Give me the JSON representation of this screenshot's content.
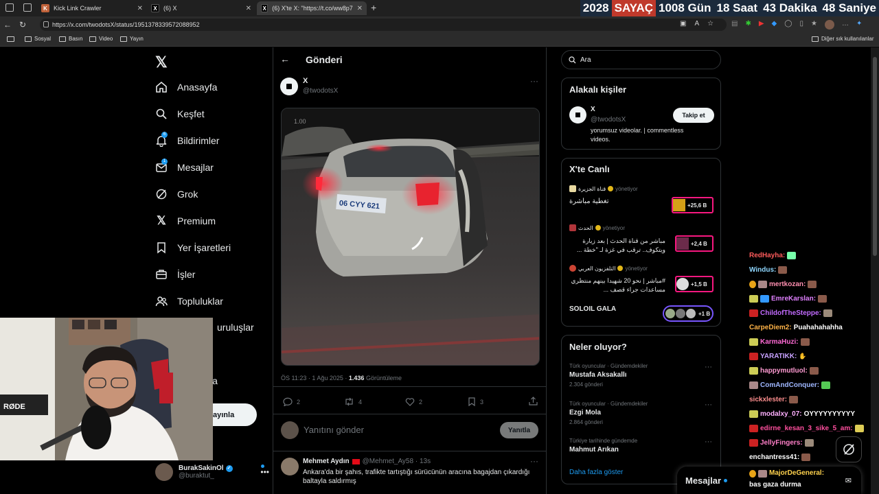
{
  "browser": {
    "tabs": [
      {
        "title": "Kick Link Crawler",
        "active": false
      },
      {
        "title": "(6) X",
        "active": false
      },
      {
        "title": "(6) X'te X: \"https://t.co/ww8p79Ob...",
        "active": true
      }
    ],
    "url": "https://x.com/twodotsX/status/1951378339572088952",
    "bookmarks": [
      "Sosyal",
      "Basın",
      "Video",
      "Yayın"
    ],
    "other_bookmarks": "Diğer sık kullanılanlar"
  },
  "counter": {
    "year": "2028",
    "label": "SAYAÇ",
    "days": "1008 Gün",
    "hours": "18 Saat",
    "minutes": "43 Dakika",
    "seconds": "48 Saniye"
  },
  "sidebar": {
    "items": [
      {
        "label": "Anasayfa",
        "icon": "home-icon"
      },
      {
        "label": "Keşfet",
        "icon": "search-icon"
      },
      {
        "label": "Bildirimler",
        "icon": "bell-icon",
        "badge": "6"
      },
      {
        "label": "Mesajlar",
        "icon": "mail-icon",
        "badge": "1"
      },
      {
        "label": "Grok",
        "icon": "grok-icon"
      },
      {
        "label": "Premium",
        "icon": "x-logo-icon"
      },
      {
        "label": "Yer İşaretleri",
        "icon": "bookmark-icon"
      },
      {
        "label": "İşler",
        "icon": "briefcase-icon"
      },
      {
        "label": "Topluluklar",
        "icon": "people-icon"
      },
      {
        "label": "uruluşlar",
        "icon": ""
      },
      {
        "label": "la",
        "icon": ""
      }
    ],
    "post_button": "ayınla",
    "account": {
      "name": "BurakSakinOl",
      "handle": "@buraktut_"
    }
  },
  "post": {
    "header": "Gönderi",
    "author_name": "X",
    "author_handle": "@twodotsX",
    "video_speed": "1.00",
    "plate": "06 CYY 621",
    "meta_time": "ÖS 11:23 · 1 Ağu 2025 · ",
    "views": "1.436",
    "views_label": " Görüntüleme",
    "stats": {
      "replies": "2",
      "reposts": "4",
      "likes": "2",
      "bookmarks": "3"
    },
    "reply_placeholder": "Yanıtını gönder",
    "reply_button": "Yanıtla",
    "reply": {
      "name": "Mehmet Aydın",
      "handle": "@Mehmet_Ay58 · 13s",
      "text": "Ankara'da bir şahıs, trafikte tartıştığı sürücünün aracına bagajdan çıkardığı baltayla saldırmış"
    }
  },
  "right": {
    "search_placeholder": "Ara",
    "related": {
      "title": "Alakalı kişiler",
      "name": "X",
      "handle": "@twodotsX",
      "bio": "yorumsuz videolar. | commentless videos.",
      "follow": "Takip et"
    },
    "live": {
      "title": "X'te Canlı",
      "items": [
        {
          "host": "قناة الجزيرة",
          "status": "yönetiyor",
          "title": "تغطية مباشرة",
          "count": "+25,6 B"
        },
        {
          "host": "الحدث",
          "status": "yönetiyor",
          "title": "مباشر من قناة الحدث | بعد زيارة ويتكوف.. ترقب في غزة لـ \"خطة ...",
          "count": "+2,4 B"
        },
        {
          "host": "التلفزيون العربي",
          "status": "yönetiyor",
          "title": "#مباشر | نحو 20 شهيدا بينهم منتظري مساعدات جراء قصف ...",
          "count": "+1,5 B"
        },
        {
          "host": "",
          "status": "",
          "title": "SOLOIL GALA",
          "count": "+1 B"
        }
      ]
    },
    "trends": {
      "title": "Neler oluyor?",
      "items": [
        {
          "context": "Türk oyuncular · Gündemdekiler",
          "name": "Mustafa Aksakallı",
          "count": "2.304 gönderi"
        },
        {
          "context": "Türk oyuncular · Gündemdekiler",
          "name": "Ezgi Mola",
          "count": "2.864 gönderi"
        },
        {
          "context": "Türkiye tarihinde gündemde",
          "name": "Mahmut Arıkan",
          "count": ""
        }
      ],
      "more": "Daha fazla göster"
    },
    "messages": "Mesajlar"
  },
  "chat": [
    {
      "user": "RedHayha:",
      "color": "#ff5b5b",
      "msg": ""
    },
    {
      "user": "Windus:",
      "color": "#8fd7ff",
      "msg": ""
    },
    {
      "user": "mertkozan:",
      "color": "#ff8fb0",
      "msg": ""
    },
    {
      "user": "EmreKarslan:",
      "color": "#e080ff",
      "msg": ""
    },
    {
      "user": "ChildofTheSteppe:",
      "color": "#c26bff",
      "msg": ""
    },
    {
      "user": "CarpeDiem2:",
      "color": "#ffb347",
      "msg": "Puahahahahha"
    },
    {
      "user": "KarmaHuzi:",
      "color": "#ff6ad5",
      "msg": ""
    },
    {
      "user": "YARATIKK:",
      "color": "#c8a2ff",
      "msg": ""
    },
    {
      "user": "happymutluol:",
      "color": "#ff9bd2",
      "msg": ""
    },
    {
      "user": "ComAndConquer:",
      "color": "#9fb7ff",
      "msg": ""
    },
    {
      "user": "sickxlester:",
      "color": "#ff8f8f",
      "msg": ""
    },
    {
      "user": "modalxy_07:",
      "color": "#ffb0ff",
      "msg": "OYYYYYYYYYY"
    },
    {
      "user": "edirne_kesan_3_sike_5_am:",
      "color": "#ff4f9e",
      "msg": ""
    },
    {
      "user": "JellyFingers:",
      "color": "#ff7fc8",
      "msg": ""
    },
    {
      "user": "enchantress41:",
      "color": "#ffffff",
      "msg": ""
    },
    {
      "user": "MajorDeGeneral:",
      "color": "#ffd24d",
      "msg": "bas gaza durma"
    }
  ],
  "colors": {
    "accent": "#1d9bf0",
    "live_pink": "#f91880",
    "live_purple": "#7856ff"
  }
}
